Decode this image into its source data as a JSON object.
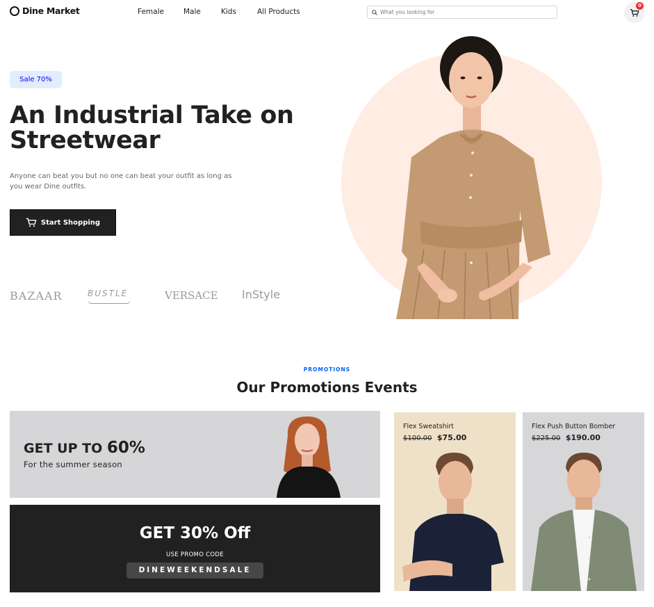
{
  "brand": {
    "name": "Dine Market",
    "icon": "logo-ring-icon"
  },
  "nav": {
    "items": [
      {
        "label": "Female"
      },
      {
        "label": "Male"
      },
      {
        "label": "Kids"
      },
      {
        "label": "All Products"
      }
    ]
  },
  "search": {
    "placeholder": "What you looking for",
    "icon": "search-icon"
  },
  "cart": {
    "count": "0",
    "icon": "cart-icon"
  },
  "hero": {
    "badge": "Sale 70%",
    "title": "An Industrial Take on Streetwear",
    "description": "Anyone can beat you but no one can beat your outfit as long as you wear Dine outfits.",
    "cta": "Start Shopping",
    "brands": [
      "BAZAAR",
      "BUSTLE",
      "VERSACE",
      "InStyle"
    ],
    "circle_color": "#ffece3"
  },
  "promotions": {
    "tag": "PROMOTIONS",
    "title": "Our Promotions Events",
    "summer": {
      "prefix": "GET UP TO",
      "highlight": "60%",
      "subtitle": "For the summer season"
    },
    "promo_code": {
      "title": "GET 30% Off",
      "label": "USE PROMO CODE",
      "code": "DINEWEEKENDSALE"
    },
    "products": [
      {
        "name": "Flex Sweatshirt",
        "old_price": "$100.00",
        "price": "$75.00",
        "bg": "#efe1c7"
      },
      {
        "name": "Flex Push Button Bomber",
        "old_price": "$225.00",
        "price": "$190.00",
        "bg": "#d7d7d9"
      }
    ]
  },
  "colors": {
    "accent_blue": "#0062f5",
    "dark": "#212121",
    "badge_bg": "#e1edff",
    "cart_badge": "#f02d34"
  }
}
